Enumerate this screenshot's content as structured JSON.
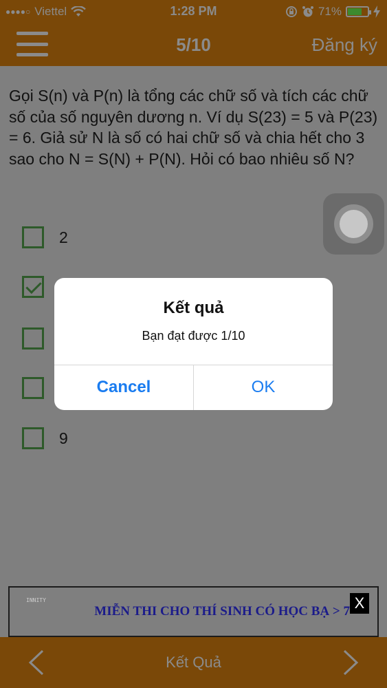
{
  "status_bar": {
    "signal_dots": "●●●●○",
    "carrier": "Viettel",
    "time": "1:28 PM",
    "battery_percent": "71%",
    "battery_level": 0.71
  },
  "nav": {
    "progress": "5/10",
    "register_label": "Đăng ký"
  },
  "question": {
    "text": "Gọi S(n) và P(n) là tổng các chữ số và tích các chữ số của số nguyên dương n. Ví dụ S(23) = 5 và P(23) = 6. Giả sử N là số có hai chữ số và chia hết cho 3 sao cho N = S(N) + P(N). Hỏi có bao nhiêu số N?"
  },
  "options": [
    {
      "label": "2",
      "checked": false
    },
    {
      "label": "",
      "checked": true
    },
    {
      "label": "",
      "checked": false
    },
    {
      "label": "",
      "checked": false
    },
    {
      "label": "9",
      "checked": false
    }
  ],
  "alert": {
    "title": "Kết quả",
    "message": "Bạn đạt được 1/10",
    "cancel_label": "Cancel",
    "ok_label": "OK"
  },
  "ad": {
    "logo_text": "INNITY",
    "text": "MIỄN THI CHO THÍ SINH CÓ HỌC BẠ > 7",
    "close_label": "X"
  },
  "bottom_bar": {
    "title": "Kết Quả"
  },
  "colors": {
    "bar_brown": "#7a4808",
    "alert_button_blue": "#1a7cf0",
    "checkbox_green": "#2e5a2a"
  },
  "icons": [
    "wifi-icon",
    "rotation-lock-icon",
    "alarm-icon",
    "battery-icon",
    "charging-icon",
    "menu-icon",
    "assistive-touch-icon",
    "chevron-left-icon",
    "chevron-right-icon"
  ]
}
